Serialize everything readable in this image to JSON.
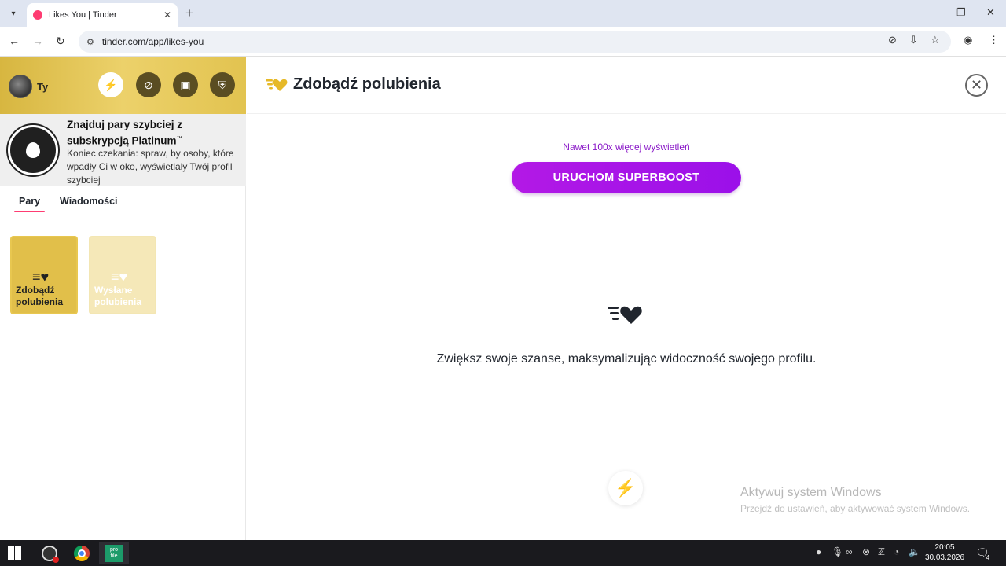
{
  "browser": {
    "tab_title": "Likes You | Tinder",
    "url": "tinder.com/app/likes-you"
  },
  "sidebar": {
    "user_label": "Ty",
    "promo": {
      "title": "Znajduj pary szybciej z subskrypcją Platinum",
      "trademark": "™",
      "text": "Koniec czekania: spraw, by osoby, które wpadły Ci w oko, wyświetlały Twój profil szybciej"
    },
    "tabs": [
      {
        "label": "Pary",
        "active": true
      },
      {
        "label": "Wiadomości",
        "active": false
      }
    ],
    "cards": [
      {
        "label": "Zdobądź polubienia"
      },
      {
        "label": "Wysłane polubienia"
      }
    ]
  },
  "main": {
    "title": "Zdobądź polubienia",
    "boost_hint": "Nawet 100x więcej wyświetleń",
    "boost_button": "URUCHOM SUPERBOOST",
    "description": "Zwiększ swoje szanse, maksymalizując widoczność swojego profilu."
  },
  "windows": {
    "activate_title": "Aktywuj system Windows",
    "activate_text": "Przejdź do ustawień, aby aktywować system Windows."
  },
  "taskbar": {
    "time": "20:05",
    "date": "30.03.2026",
    "profile_app_label_1": "pro",
    "profile_app_label_2": "file",
    "notification_count": "4"
  },
  "colors": {
    "tinder_pink": "#fe3c72",
    "gold": "#e1bf4a",
    "superboost_purple": "#9b10e9"
  }
}
